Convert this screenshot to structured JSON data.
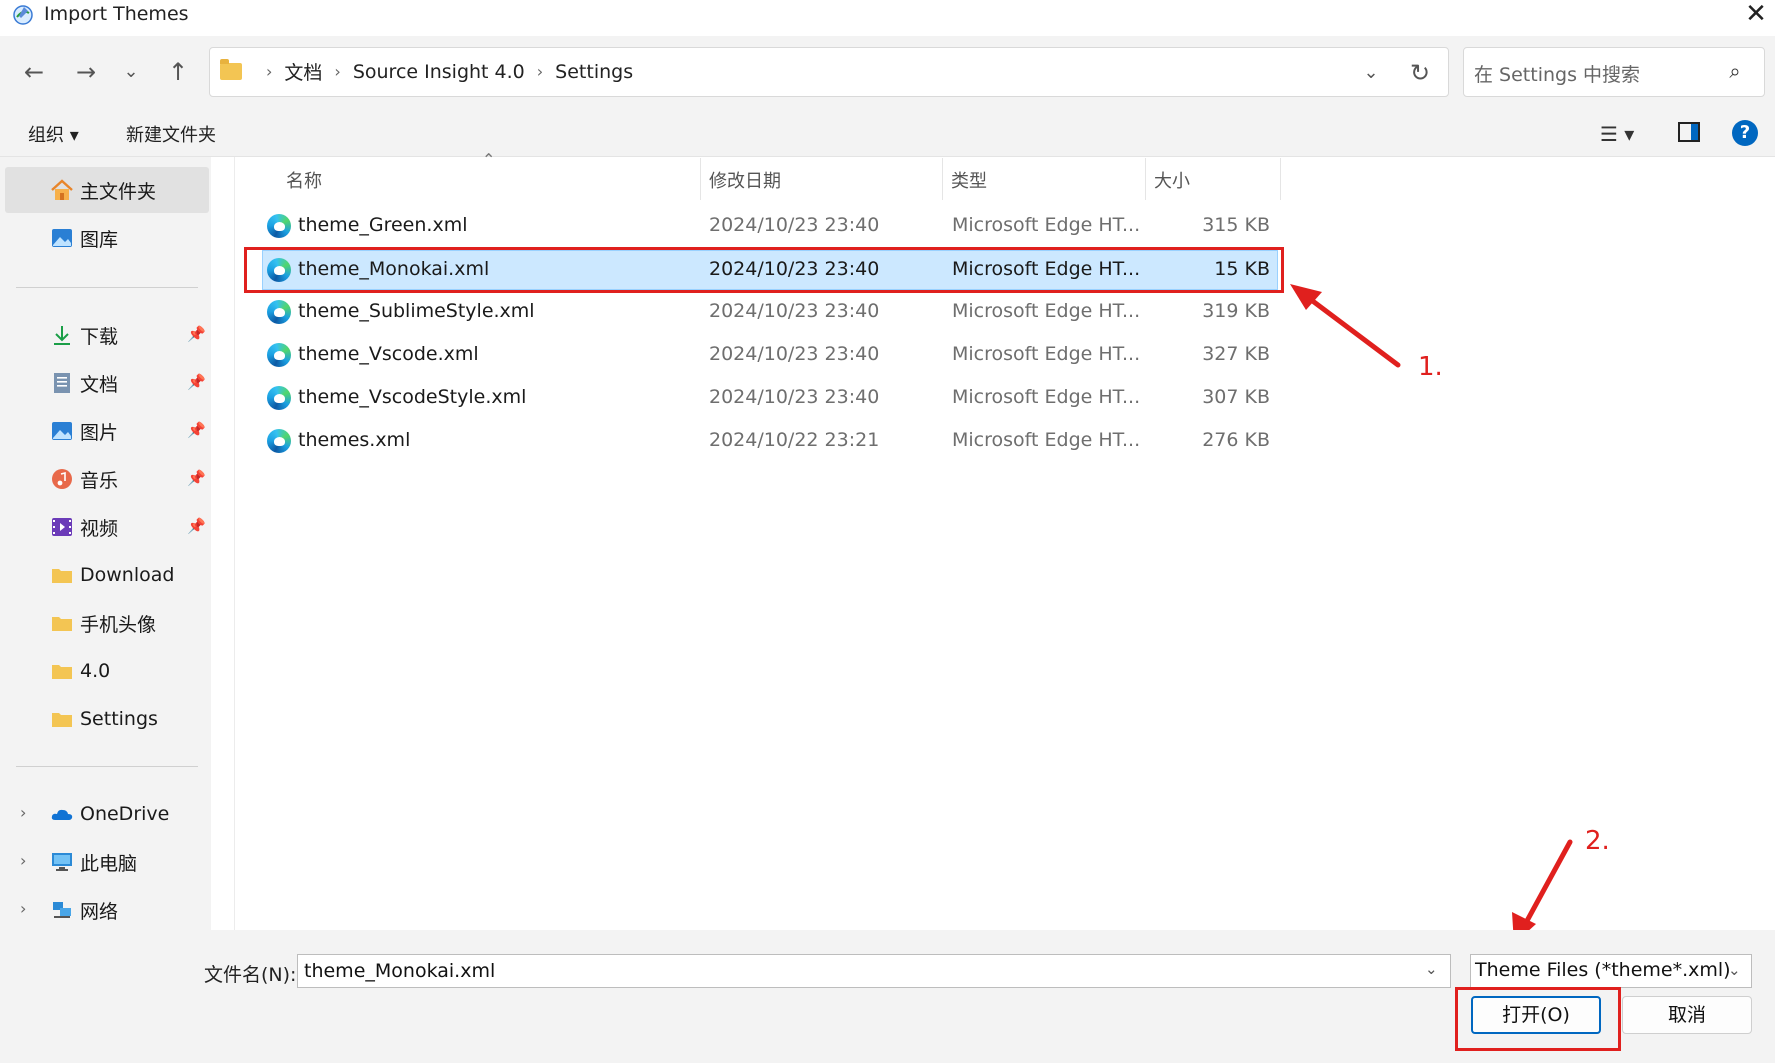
{
  "window": {
    "title": "Import Themes",
    "close_label": "✕"
  },
  "nav": {
    "back": "←",
    "forward": "→",
    "recent": "⌄",
    "up": "↑",
    "breadcrumb": [
      "文档",
      "Source Insight 4.0",
      "Settings"
    ],
    "crumb_sep": "›",
    "addr_dropdown": "⌄",
    "refresh": "↻",
    "search_placeholder": "在 Settings 中搜索",
    "search_icon": "⌕"
  },
  "toolbar": {
    "organize": "组织 ▾",
    "new_folder": "新建文件夹",
    "view_icon": "☰ ▾",
    "help": "?"
  },
  "sidebar": {
    "home": "主文件夹",
    "gallery": "图库",
    "pinned": [
      "下载",
      "文档",
      "图片",
      "音乐",
      "视频"
    ],
    "folders": [
      "Download",
      "手机头像",
      "4.0",
      "Settings"
    ],
    "locations": [
      "OneDrive",
      "此电脑",
      "网络"
    ],
    "pin_icon": "📌",
    "expand": "›"
  },
  "columns": {
    "name": "名称",
    "date": "修改日期",
    "type": "类型",
    "size": "大小",
    "sort_indicator": "⌃"
  },
  "files": [
    {
      "name": "theme_Green.xml",
      "date": "2024/10/23 23:40",
      "type": "Microsoft Edge HT...",
      "size": "315 KB"
    },
    {
      "name": "theme_Monokai.xml",
      "date": "2024/10/23 23:40",
      "type": "Microsoft Edge HT...",
      "size": "15 KB"
    },
    {
      "name": "theme_SublimeStyle.xml",
      "date": "2024/10/23 23:40",
      "type": "Microsoft Edge HT...",
      "size": "319 KB"
    },
    {
      "name": "theme_Vscode.xml",
      "date": "2024/10/23 23:40",
      "type": "Microsoft Edge HT...",
      "size": "327 KB"
    },
    {
      "name": "theme_VscodeStyle.xml",
      "date": "2024/10/23 23:40",
      "type": "Microsoft Edge HT...",
      "size": "307 KB"
    },
    {
      "name": "themes.xml",
      "date": "2024/10/22 23:21",
      "type": "Microsoft Edge HT...",
      "size": "276 KB"
    }
  ],
  "selected_index": 1,
  "annotations": {
    "step1": "1.",
    "step2": "2.",
    "color": "#e0201e"
  },
  "footer": {
    "filename_label": "文件名(N):",
    "filename_value": "theme_Monokai.xml",
    "filetype": "Theme Files (*theme*.xml)",
    "dropdown": "⌄",
    "open": "打开(O)",
    "cancel": "取消"
  },
  "colors": {
    "accent": "#0067c0",
    "selection_bg": "#cce8ff",
    "selection_border": "#99d1ff",
    "folder": "#f3c553"
  }
}
